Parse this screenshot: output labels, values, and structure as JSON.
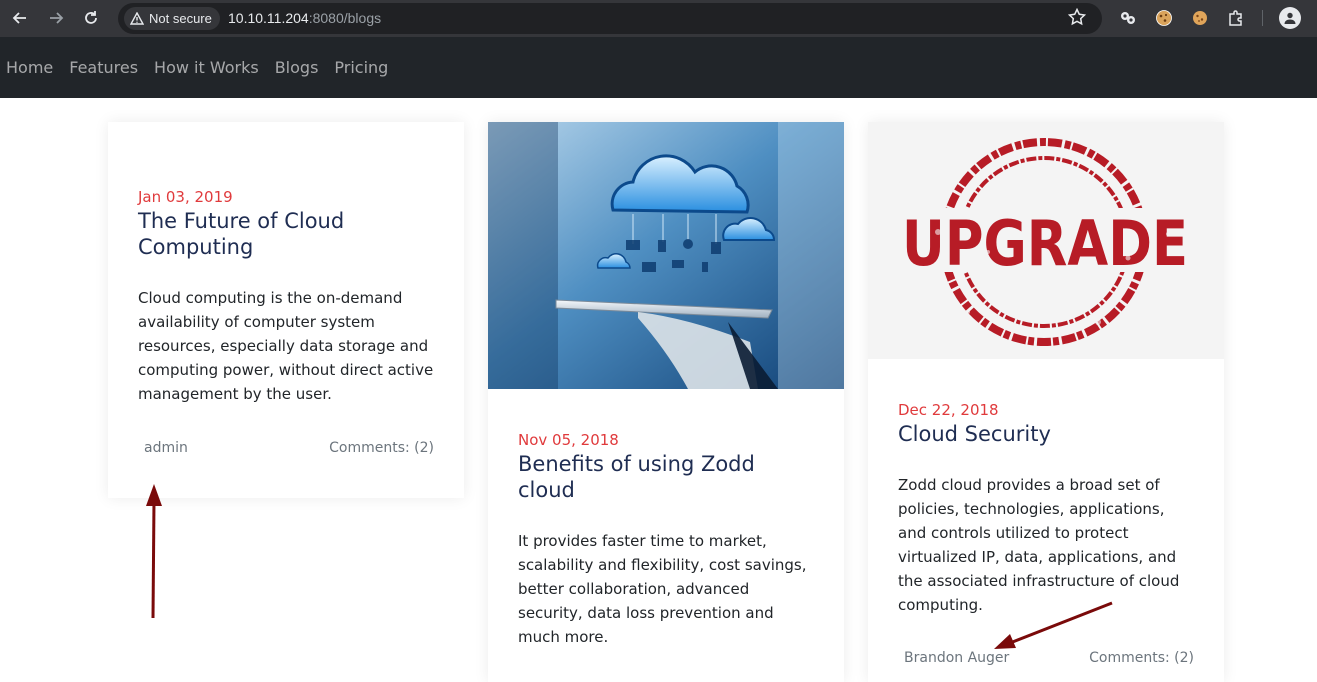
{
  "browser": {
    "security_label": "Not secure",
    "url_host": "10.10.11.204",
    "url_path": ":8080/blogs"
  },
  "nav": {
    "items": [
      "Home",
      "Features",
      "How it Works",
      "Blogs",
      "Pricing"
    ]
  },
  "posts": [
    {
      "date": "Jan 03, 2019",
      "title": "The Future of Cloud Computing",
      "text": "Cloud computing is the on-demand availability of computer system resources, especially data storage and computing power, without direct active management by the user.",
      "author": "admin",
      "comments": "Comments: (2)"
    },
    {
      "date": "Nov 05, 2018",
      "title": "Benefits of using Zodd cloud",
      "text": "It provides faster time to market, scalability and flexibility, cost savings, better collaboration, advanced security, data loss prevention and much more.",
      "image": "cloud-computing-tablet-image"
    },
    {
      "date": "Dec 22, 2018",
      "title": "Cloud Security",
      "text": "Zodd cloud provides a broad set of policies, technologies, applications, and controls utilized to protect virtualized IP, data, applications, and the associated infrastructure of cloud computing.",
      "author": "Brandon Auger",
      "comments": "Comments: (2)",
      "image": "upgrade-stamp-image",
      "stamp_text": "UPGRADE"
    }
  ],
  "colors": {
    "date": "#e03a3c",
    "title": "#1f2d52",
    "nav_bg": "#212529",
    "annotation_arrow": "#7a0a0a"
  }
}
